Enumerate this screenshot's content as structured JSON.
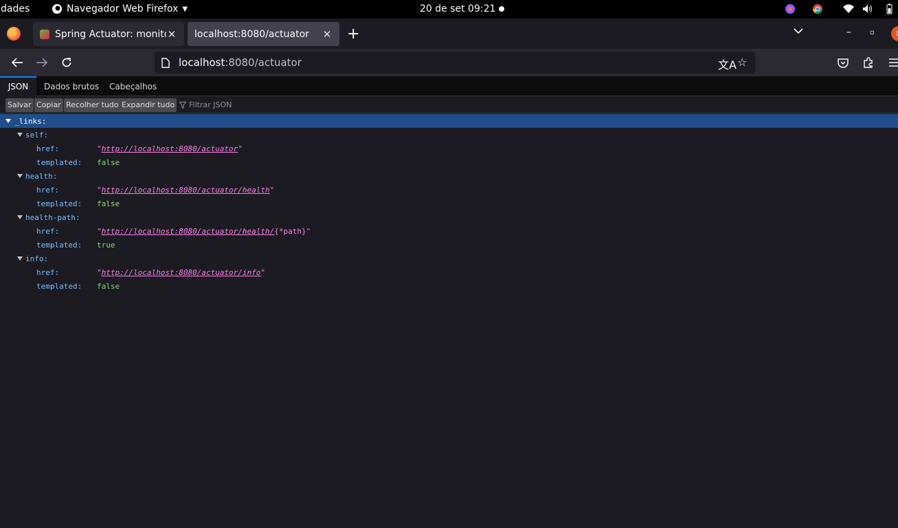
{
  "topbar": {
    "activities": "dades",
    "app_name": "Navegador Web Firefox",
    "clock": "20 de set  09:21"
  },
  "tabs": [
    {
      "title": "Spring Actuator: monitor",
      "active": false
    },
    {
      "title": "localhost:8080/actuator",
      "active": true
    }
  ],
  "urlbar": {
    "host": "localhost",
    "rest": ":8080/actuator"
  },
  "json_viewer": {
    "tabs": [
      "JSON",
      "Dados brutos",
      "Cabeçalhos"
    ],
    "buttons": [
      "Salvar",
      "Copiar",
      "Recolher tudo",
      "Expandir tudo"
    ],
    "filter_placeholder": "Filtrar JSON"
  },
  "tree": {
    "root_key": "_links:",
    "entries": [
      {
        "key": "self:",
        "href_key": "href:",
        "href_url": "http://localhost:8080/actuator",
        "href_suffix": "",
        "templated_key": "templated:",
        "templated": "false"
      },
      {
        "key": "health:",
        "href_key": "href:",
        "href_url": "http://localhost:8080/actuator/health",
        "href_suffix": "",
        "templated_key": "templated:",
        "templated": "false"
      },
      {
        "key": "health-path:",
        "href_key": "href:",
        "href_url": "http://localhost:8080/actuator/health/",
        "href_suffix": "{*path}",
        "templated_key": "templated:",
        "templated": "true"
      },
      {
        "key": "info:",
        "href_key": "href:",
        "href_url": "http://localhost:8080/actuator/info",
        "href_suffix": "",
        "templated_key": "templated:",
        "templated": "false"
      }
    ]
  },
  "colors": {
    "selection": "#204e8a",
    "key": "#75bfff",
    "string": "#ff7de9",
    "boolean": "#86de74",
    "accent": "#0a84ff"
  }
}
